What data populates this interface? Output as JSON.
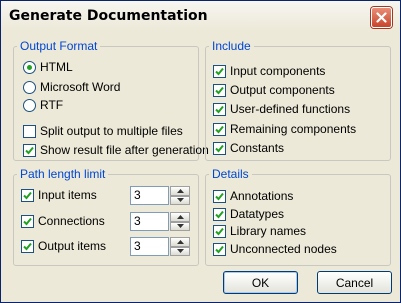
{
  "window": {
    "title": "Generate Documentation"
  },
  "output_format": {
    "legend": "Output Format",
    "options": [
      {
        "label": "HTML",
        "selected": true
      },
      {
        "label": "Microsoft Word",
        "selected": false
      },
      {
        "label": "RTF",
        "selected": false
      }
    ],
    "checkboxes": [
      {
        "label": "Split output to multiple files",
        "checked": false
      },
      {
        "label": "Show result file after generation",
        "checked": true
      }
    ]
  },
  "include": {
    "legend": "Include",
    "items": [
      {
        "label": "Input components",
        "checked": true
      },
      {
        "label": "Output components",
        "checked": true
      },
      {
        "label": "User-defined functions",
        "checked": true
      },
      {
        "label": "Remaining components",
        "checked": true
      },
      {
        "label": "Constants",
        "checked": true
      }
    ]
  },
  "path_length": {
    "legend": "Path length limit",
    "items": [
      {
        "label": "Input items",
        "checked": true,
        "value": "3"
      },
      {
        "label": "Connections",
        "checked": true,
        "value": "3"
      },
      {
        "label": "Output items",
        "checked": true,
        "value": "3"
      }
    ]
  },
  "details": {
    "legend": "Details",
    "items": [
      {
        "label": "Annotations",
        "checked": true
      },
      {
        "label": "Datatypes",
        "checked": true
      },
      {
        "label": "Library names",
        "checked": true
      },
      {
        "label": "Unconnected nodes",
        "checked": true
      }
    ]
  },
  "buttons": {
    "ok": "OK",
    "cancel": "Cancel"
  }
}
